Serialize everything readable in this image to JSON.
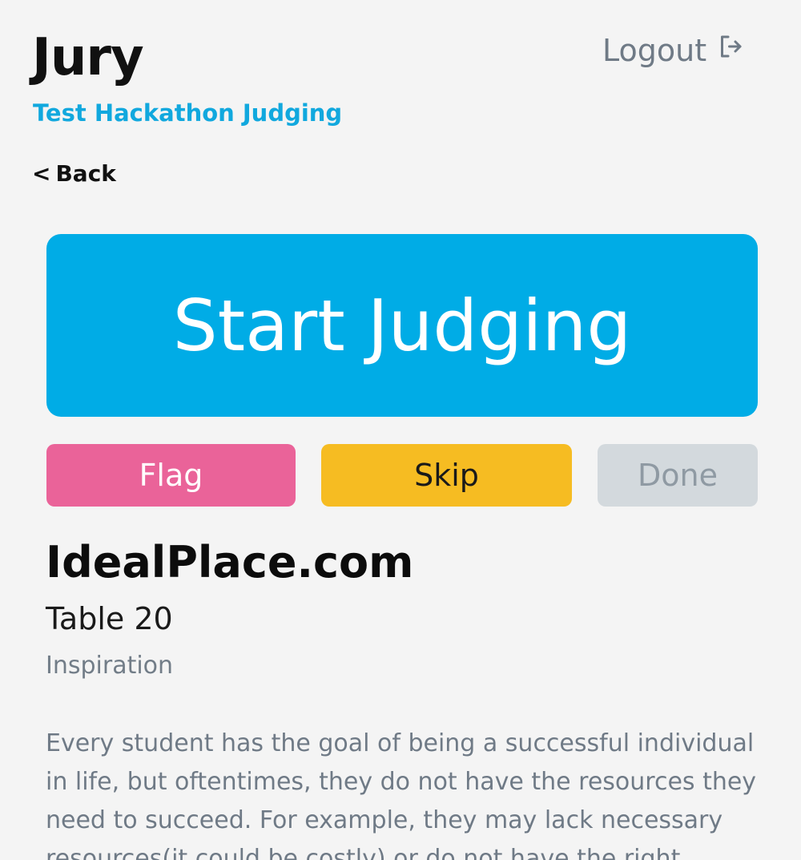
{
  "header": {
    "title": "Jury",
    "subtitle": "Test Hackathon Judging",
    "logout_label": "Logout"
  },
  "nav": {
    "back_label": "Back"
  },
  "main": {
    "start_label": "Start Judging",
    "actions": {
      "flag_label": "Flag",
      "skip_label": "Skip",
      "done_label": "Done"
    }
  },
  "project": {
    "name": "IdealPlace.com",
    "table": "Table 20",
    "section_label": "Inspiration",
    "description": "Every student has the goal of being a successful individual in life, but oftentimes, they do not have the resources they need to succeed. For example, they may lack necessary resources(it could be costly) or do not have the right"
  },
  "colors": {
    "accent": "#00ace6",
    "flag": "#ea6399",
    "skip": "#f6bc22",
    "done_disabled": "#d3d9dd",
    "subtitle": "#11a8de"
  },
  "icons": {
    "logout": "logout-icon",
    "back": "chevron-left-icon"
  }
}
